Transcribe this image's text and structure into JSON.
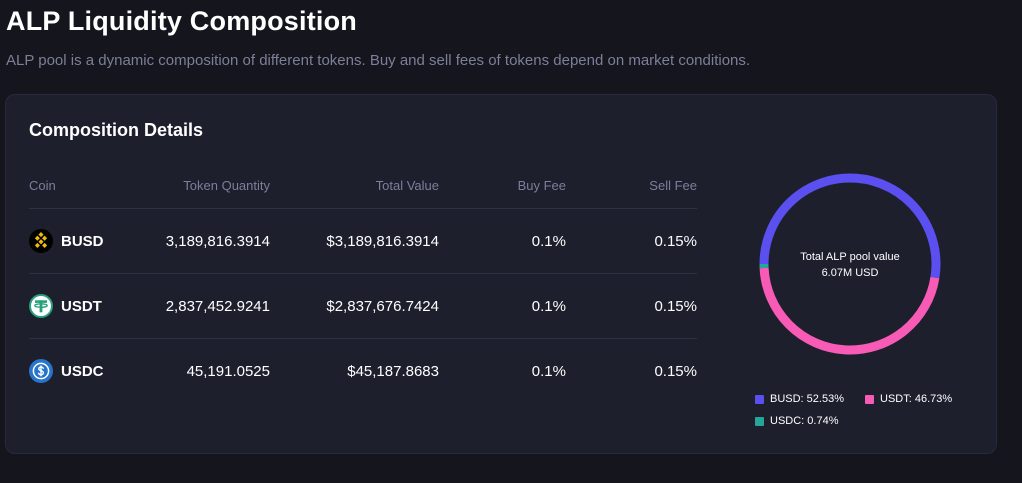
{
  "page": {
    "title": "ALP Liquidity Composition",
    "subtitle": "ALP pool is a dynamic composition of different tokens. Buy and sell fees of tokens depend on market conditions."
  },
  "card": {
    "title": "Composition Details"
  },
  "table": {
    "headers": {
      "coin": "Coin",
      "quantity": "Token Quantity",
      "value": "Total Value",
      "buy_fee": "Buy Fee",
      "sell_fee": "Sell Fee"
    },
    "rows": [
      {
        "coin": "BUSD",
        "icon": "busd-icon",
        "quantity": "3,189,816.3914",
        "value": "$3,189,816.3914",
        "buy_fee": "0.1%",
        "sell_fee": "0.15%"
      },
      {
        "coin": "USDT",
        "icon": "usdt-icon",
        "quantity": "2,837,452.9241",
        "value": "$2,837,676.7424",
        "buy_fee": "0.1%",
        "sell_fee": "0.15%"
      },
      {
        "coin": "USDC",
        "icon": "usdc-icon",
        "quantity": "45,191.0525",
        "value": "$45,187.8683",
        "buy_fee": "0.1%",
        "sell_fee": "0.15%"
      }
    ]
  },
  "chart_data": {
    "type": "pie",
    "center_label": "Total ALP pool value",
    "center_value": "6.07M USD",
    "series": [
      {
        "name": "BUSD",
        "value": 52.53,
        "label": "BUSD: 52.53%",
        "color": "#5b4ff0"
      },
      {
        "name": "USDT",
        "value": 46.73,
        "label": "USDT: 46.73%",
        "color": "#f75bb6"
      },
      {
        "name": "USDC",
        "value": 0.74,
        "label": "USDC: 0.74%",
        "color": "#26a69a"
      }
    ]
  },
  "colors": {
    "background": "#14151d",
    "card": "#1d1f2d",
    "muted_text": "#7c7f99",
    "busd": "#f0b90b",
    "usdt": "#26a17b",
    "usdc": "#2775ca"
  }
}
